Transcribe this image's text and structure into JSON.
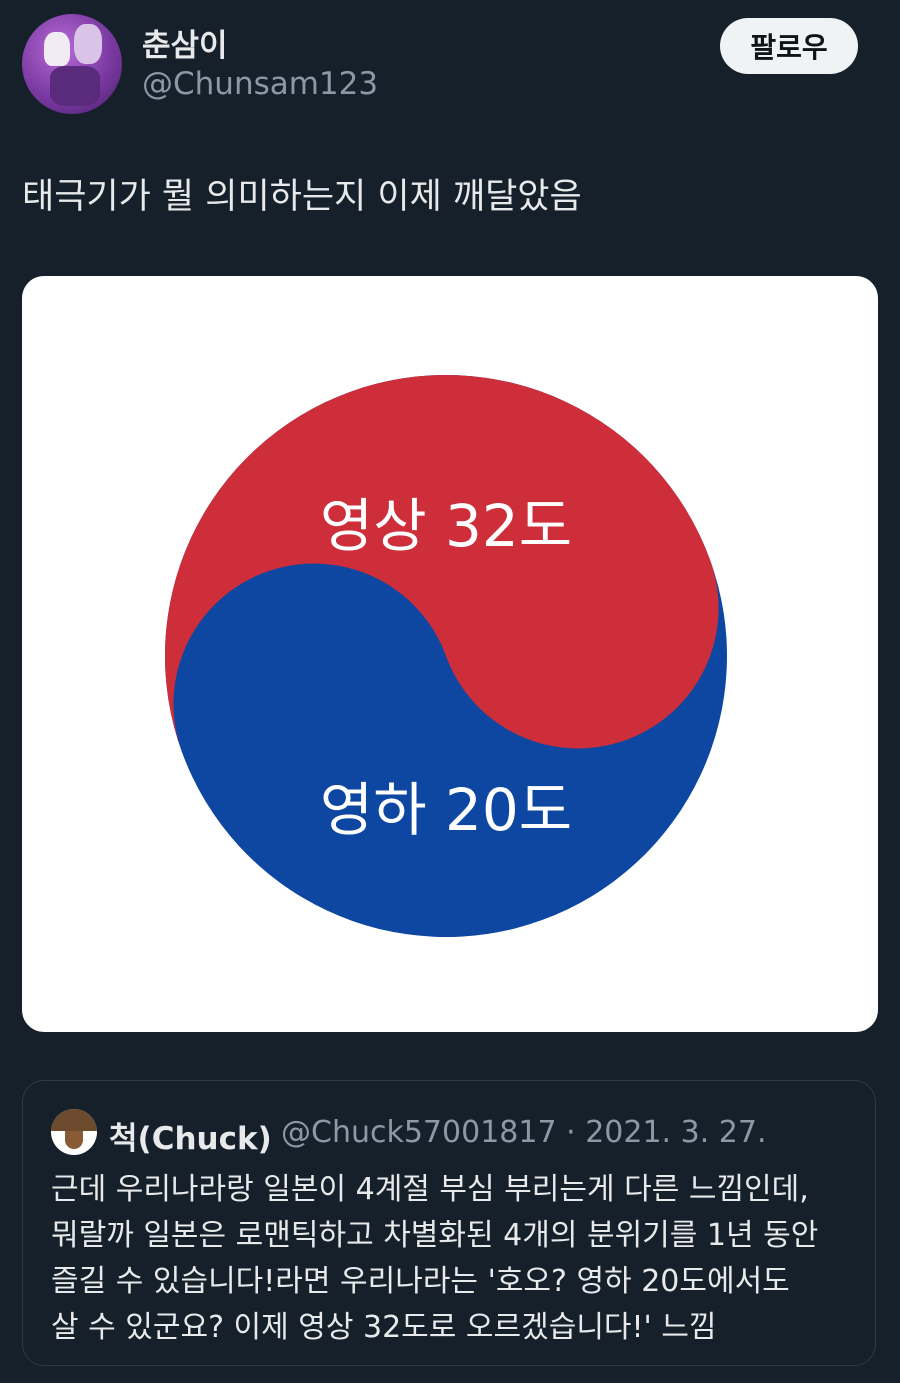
{
  "tweet": {
    "author_name": "춘삼이",
    "author_handle": "@Chunsam123",
    "follow_label": "팔로우",
    "text": "태극기가 뭘 의미하는지 이제 깨달았음",
    "avatar_icon": "cartoon-avatar-icon"
  },
  "image": {
    "top_label": "영상 32도",
    "bottom_label": "영하 20도",
    "colors": {
      "red": "#cd2e3a",
      "blue": "#0d47a1"
    }
  },
  "quote": {
    "author_name": "척(Chuck)",
    "author_handle": "@Chuck57001817",
    "separator": "·",
    "date": "2021. 3. 27.",
    "lines": [
      "근데 우리나라랑 일본이 4계절 부심 부리는게 다른 느낌인데,",
      "뭐랄까 일본은 로맨틱하고 차별화된 4개의 분위기를 1년 동안",
      "즐길 수 있습니다!라면 우리나라는 '호오? 영하 20도에서도",
      "살 수 있군요? 이제 영상 32도로 오르겠습니다!' 느낌"
    ]
  }
}
